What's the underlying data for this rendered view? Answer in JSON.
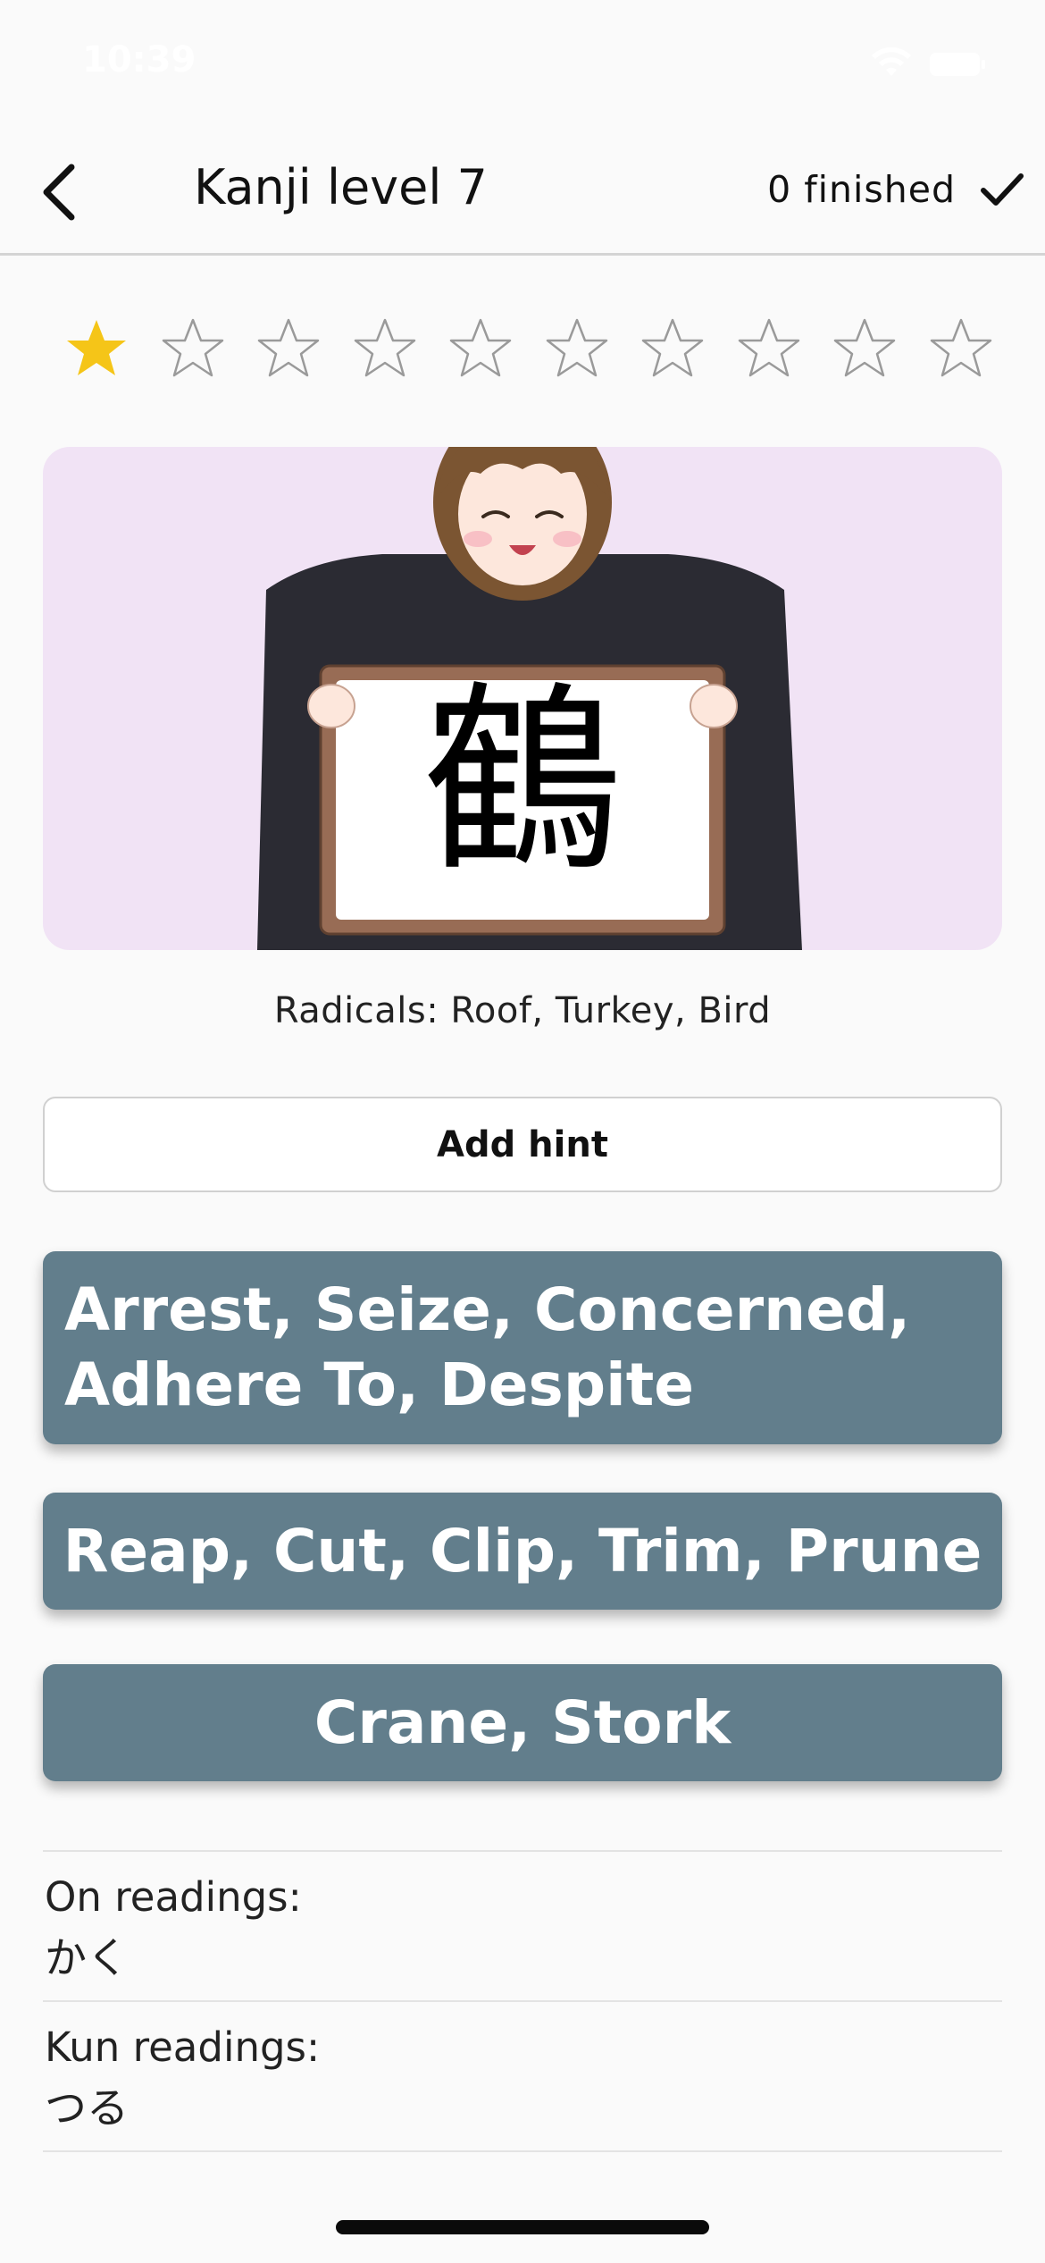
{
  "status_bar": {
    "time": "10:39"
  },
  "nav": {
    "title": "Kanji level 7",
    "finished_label": "0 finished"
  },
  "rating": {
    "filled": 1,
    "total": 10,
    "filled_color": "#f5c518",
    "empty_color": "#9a9a9a"
  },
  "card": {
    "kanji": "鶴",
    "background_color": "#f1e3f5"
  },
  "radicals_text": "Radicals: Roof, Turkey, Bird",
  "hint_button_label": "Add hint",
  "answers": [
    {
      "label": "Arrest, Seize, Concerned, Adhere To, Despite"
    },
    {
      "label": "Reap, Cut, Clip, Trim, Prune"
    },
    {
      "label": "Crane, Stork"
    }
  ],
  "answer_color": "#627e8c",
  "readings": {
    "on_label": "On readings:",
    "on_value": "かく",
    "kun_label": "Kun readings:",
    "kun_value": "つる"
  }
}
